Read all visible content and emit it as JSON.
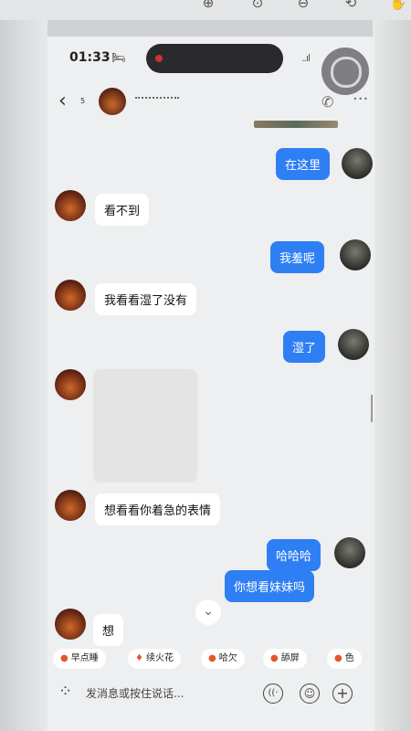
{
  "viewer": {
    "icons": [
      "zoom-in-icon",
      "actual-size-icon",
      "zoom-out-icon",
      "rotate-icon",
      "hand-icon"
    ]
  },
  "status": {
    "time": "01:33",
    "bed_icon": "🛏",
    "signal": "..ıl"
  },
  "nav": {
    "back": "‹",
    "unread": "5",
    "phone": "✆",
    "more": "···"
  },
  "messages": [
    {
      "side": "out",
      "text": "在这里"
    },
    {
      "side": "in",
      "text": "看不到"
    },
    {
      "side": "out",
      "text": "我羞呢"
    },
    {
      "side": "in",
      "text": "我看看湿了没有"
    },
    {
      "side": "out",
      "text": "湿了"
    },
    {
      "side": "in",
      "type": "image"
    },
    {
      "side": "in",
      "text": "想看看你着急的表情"
    },
    {
      "side": "out",
      "text": "哈哈哈"
    },
    {
      "side": "out",
      "text": "你想看妹妹吗"
    },
    {
      "side": "in",
      "text": "想"
    }
  ],
  "jump_down": "⌄",
  "chips": [
    {
      "icon": "●",
      "label": "早点睡"
    },
    {
      "icon": "♦",
      "label": "续火花"
    },
    {
      "icon": "●",
      "label": "哈欠"
    },
    {
      "icon": "●",
      "label": "舔屏"
    },
    {
      "icon": "●",
      "label": "色"
    }
  ],
  "input": {
    "grid": "⁘",
    "placeholder": "发消息或按住说话...",
    "voice": "((·",
    "emoji": "☺",
    "plus": "+"
  }
}
